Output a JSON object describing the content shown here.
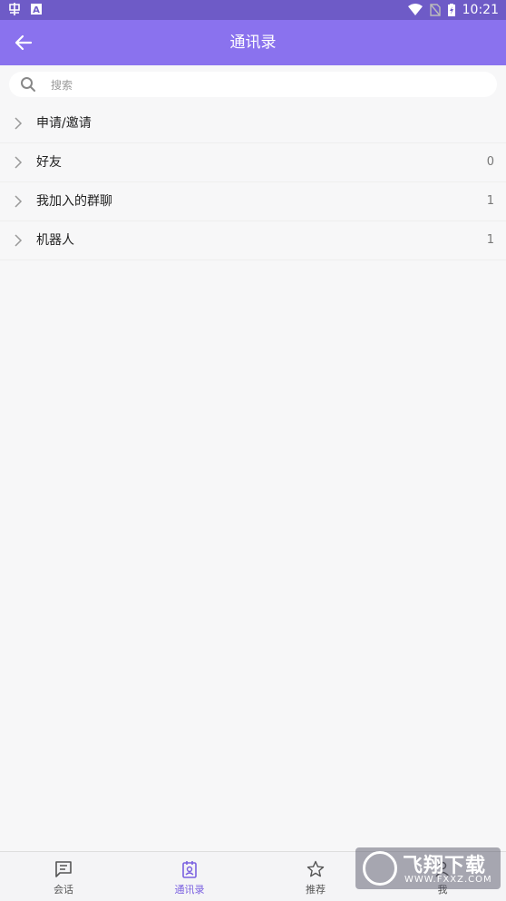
{
  "status_bar": {
    "time": "10:21"
  },
  "app_bar": {
    "title": "通讯录"
  },
  "search": {
    "placeholder": "搜索"
  },
  "list": [
    {
      "label": "申请/邀请",
      "count": ""
    },
    {
      "label": "好友",
      "count": "0"
    },
    {
      "label": "我加入的群聊",
      "count": "1"
    },
    {
      "label": "机器人",
      "count": "1"
    }
  ],
  "bottom_nav": [
    {
      "label": "会话",
      "icon": "chat-icon",
      "active": false
    },
    {
      "label": "通讯录",
      "icon": "contacts-icon",
      "active": true
    },
    {
      "label": "推荐",
      "icon": "star-icon",
      "active": false
    },
    {
      "label": "我",
      "icon": "person-icon",
      "active": false
    }
  ],
  "watermark": {
    "text": "飞翔下载",
    "url": "WWW.FXXZ.COM"
  },
  "colors": {
    "status_bar": "#6e5bc7",
    "app_bar": "#8a72ee",
    "active_tab": "#7a60e0"
  }
}
